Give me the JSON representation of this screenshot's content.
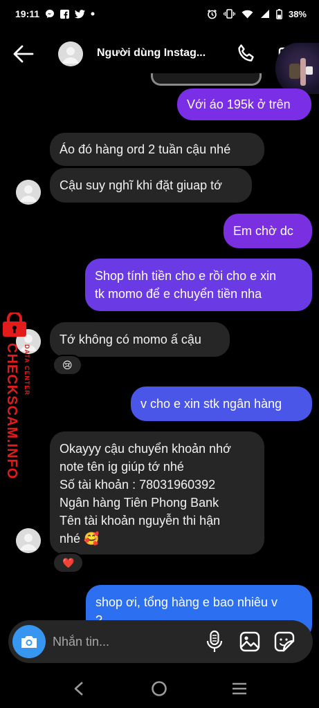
{
  "status_bar": {
    "time": "19:11",
    "battery": "38%",
    "left_icons": [
      "messenger-icon",
      "facebook-icon",
      "twitter-icon",
      "dot-icon"
    ],
    "right_icons": [
      "alarm-icon",
      "vibrate-icon",
      "wifi-icon",
      "signal-icon",
      "battery-icon"
    ]
  },
  "header": {
    "title": "Người dùng Instag...",
    "icons": [
      "back-arrow-icon",
      "phone-icon",
      "video-camera-icon"
    ]
  },
  "messages": [
    {
      "id": "m1",
      "side": "out",
      "text": "Với áo 195k ở trên",
      "color": "#7a2ee6"
    },
    {
      "id": "m2",
      "side": "in",
      "text": "Áo đó hàng ord 2 tuần cậu nhé"
    },
    {
      "id": "m3",
      "side": "in",
      "text": "Cậu suy nghĩ khi đặt giuap tớ"
    },
    {
      "id": "m4",
      "side": "out",
      "text": "Em chờ dc",
      "color": "#7a30e0"
    },
    {
      "id": "m5",
      "side": "out",
      "lines": [
        "Shop tính tiền cho e rồi cho e xin",
        "tk momo để e chuyển tiền nha"
      ],
      "color": "#6a3ae4"
    },
    {
      "id": "m6",
      "side": "in",
      "text": "Tớ không có momo ấ cậu",
      "reaction": "😢"
    },
    {
      "id": "m7",
      "side": "out",
      "text": "v cho e xin stk ngân hàng",
      "color": "#4a56e8"
    },
    {
      "id": "m8",
      "side": "in",
      "lines": [
        "Okayyy cậu chuyển khoản nhớ",
        "note tên ig giúp tớ nhé",
        "Số tài khoản : 78031960392",
        "Ngân hàng Tiên Phong Bank",
        "Tên tài khoản nguyễn thi hận",
        "nhé 🥰"
      ],
      "reaction": "❤️"
    },
    {
      "id": "m9",
      "side": "out",
      "lines": [
        "shop ơi, tổng hàng e bao nhiêu v",
        "?"
      ],
      "color": "#2c6ff0"
    }
  ],
  "watermark": {
    "text": "CHECKSCAM.INFO",
    "subtext": "DATA CENTER",
    "color": "#e21b1b"
  },
  "composer": {
    "placeholder": "Nhắn tin...",
    "accent": "#3797f0",
    "icons": [
      "camera-icon",
      "microphone-icon",
      "gallery-icon",
      "sticker-icon"
    ]
  },
  "nav": {
    "icons": [
      "nav-back-icon",
      "nav-home-icon",
      "nav-recent-apps-icon"
    ]
  }
}
